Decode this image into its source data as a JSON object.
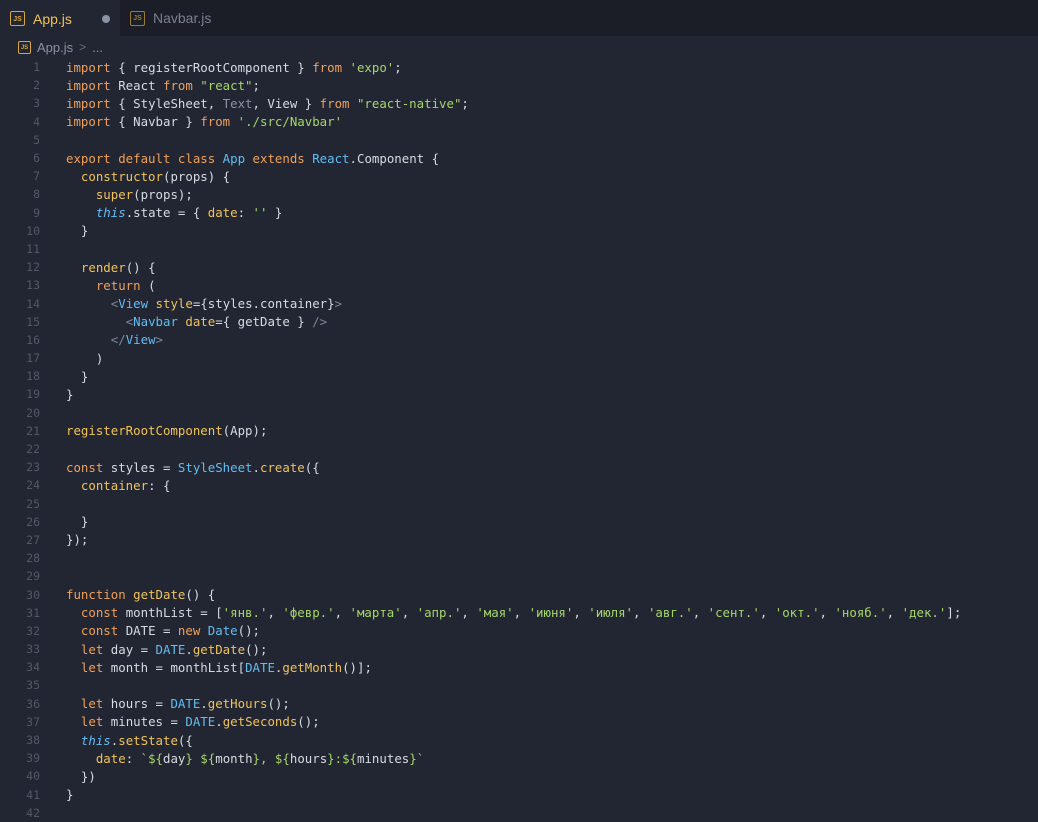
{
  "tabs": [
    {
      "label": "App.js",
      "icon_text": "JS",
      "active": true,
      "modified": true
    },
    {
      "label": "Navbar.js",
      "icon_text": "JS",
      "active": false,
      "modified": false
    }
  ],
  "breadcrumb": {
    "icon_text": "JS",
    "file": "App.js",
    "separator": ">",
    "rest": "..."
  },
  "colors": {
    "background": "#222632",
    "tabbar": "#1b1e27",
    "keyword": "#f0a05a",
    "string": "#a5d66b",
    "function": "#f0c35a",
    "class": "#61bdf2"
  },
  "lines": [
    [
      [
        "kw",
        "import"
      ],
      [
        "plain",
        " { registerRootComponent } "
      ],
      [
        "kw",
        "from"
      ],
      [
        "plain",
        " "
      ],
      [
        "str",
        "'expo'"
      ],
      [
        "plain",
        ";"
      ]
    ],
    [
      [
        "kw",
        "import"
      ],
      [
        "plain",
        " React "
      ],
      [
        "kw",
        "from"
      ],
      [
        "plain",
        " "
      ],
      [
        "str",
        "\"react\""
      ],
      [
        "plain",
        ";"
      ]
    ],
    [
      [
        "kw",
        "import"
      ],
      [
        "plain",
        " { StyleSheet, "
      ],
      [
        "dim",
        "Text"
      ],
      [
        "plain",
        ", View } "
      ],
      [
        "kw",
        "from"
      ],
      [
        "plain",
        " "
      ],
      [
        "str",
        "\"react-native\""
      ],
      [
        "plain",
        ";"
      ]
    ],
    [
      [
        "kw",
        "import"
      ],
      [
        "plain",
        " { Navbar } "
      ],
      [
        "kw",
        "from"
      ],
      [
        "plain",
        " "
      ],
      [
        "str",
        "'./src/Navbar'"
      ]
    ],
    [],
    [
      [
        "kw",
        "export default class"
      ],
      [
        "plain",
        " "
      ],
      [
        "cls",
        "App"
      ],
      [
        "plain",
        " "
      ],
      [
        "kw",
        "extends"
      ],
      [
        "plain",
        " "
      ],
      [
        "cls",
        "React"
      ],
      [
        "plain",
        "."
      ],
      [
        "plain",
        "Component {"
      ]
    ],
    [
      [
        "plain",
        "  "
      ],
      [
        "fn",
        "constructor"
      ],
      [
        "plain",
        "(props) {"
      ]
    ],
    [
      [
        "plain",
        "    "
      ],
      [
        "fn",
        "super"
      ],
      [
        "plain",
        "(props);"
      ]
    ],
    [
      [
        "plain",
        "    "
      ],
      [
        "this",
        "this"
      ],
      [
        "plain",
        ".state = { "
      ],
      [
        "fn",
        "date"
      ],
      [
        "plain",
        ": "
      ],
      [
        "str",
        "''"
      ],
      [
        "plain",
        " }"
      ]
    ],
    [
      [
        "plain",
        "  }"
      ]
    ],
    [],
    [
      [
        "plain",
        "  "
      ],
      [
        "fn",
        "render"
      ],
      [
        "plain",
        "() {"
      ]
    ],
    [
      [
        "plain",
        "    "
      ],
      [
        "kw",
        "return"
      ],
      [
        "plain",
        " ("
      ]
    ],
    [
      [
        "plain",
        "      "
      ],
      [
        "brk",
        "<"
      ],
      [
        "tag",
        "View"
      ],
      [
        "plain",
        " "
      ],
      [
        "attr",
        "style"
      ],
      [
        "plain",
        "={styles.container}"
      ],
      [
        "brk",
        ">"
      ]
    ],
    [
      [
        "plain",
        "        "
      ],
      [
        "brk",
        "<"
      ],
      [
        "tag",
        "Navbar"
      ],
      [
        "plain",
        " "
      ],
      [
        "attr",
        "date"
      ],
      [
        "plain",
        "={ getDate } "
      ],
      [
        "brk",
        "/>"
      ]
    ],
    [
      [
        "plain",
        "      "
      ],
      [
        "brk",
        "</"
      ],
      [
        "tag",
        "View"
      ],
      [
        "brk",
        ">"
      ]
    ],
    [
      [
        "plain",
        "    )"
      ]
    ],
    [
      [
        "plain",
        "  }"
      ]
    ],
    [
      [
        "plain",
        "}"
      ]
    ],
    [],
    [
      [
        "fn",
        "registerRootComponent"
      ],
      [
        "plain",
        "(App);"
      ]
    ],
    [],
    [
      [
        "kw",
        "const"
      ],
      [
        "plain",
        " styles = "
      ],
      [
        "cls",
        "StyleSheet"
      ],
      [
        "plain",
        "."
      ],
      [
        "fn",
        "create"
      ],
      [
        "plain",
        "({"
      ]
    ],
    [
      [
        "plain",
        "  "
      ],
      [
        "fn",
        "container"
      ],
      [
        "plain",
        ": {"
      ]
    ],
    [],
    [
      [
        "plain",
        "  }"
      ]
    ],
    [
      [
        "plain",
        "});"
      ]
    ],
    [],
    [],
    [
      [
        "kw",
        "function"
      ],
      [
        "plain",
        " "
      ],
      [
        "fn",
        "getDate"
      ],
      [
        "plain",
        "() {"
      ]
    ],
    [
      [
        "plain",
        "  "
      ],
      [
        "kw",
        "const"
      ],
      [
        "plain",
        " monthList = ["
      ],
      [
        "str",
        "'янв.'"
      ],
      [
        "plain",
        ", "
      ],
      [
        "str",
        "'февр.'"
      ],
      [
        "plain",
        ", "
      ],
      [
        "str",
        "'марта'"
      ],
      [
        "plain",
        ", "
      ],
      [
        "str",
        "'апр.'"
      ],
      [
        "plain",
        ", "
      ],
      [
        "str",
        "'мая'"
      ],
      [
        "plain",
        ", "
      ],
      [
        "str",
        "'июня'"
      ],
      [
        "plain",
        ", "
      ],
      [
        "str",
        "'июля'"
      ],
      [
        "plain",
        ", "
      ],
      [
        "str",
        "'авг.'"
      ],
      [
        "plain",
        ", "
      ],
      [
        "str",
        "'сент.'"
      ],
      [
        "plain",
        ", "
      ],
      [
        "str",
        "'окт.'"
      ],
      [
        "plain",
        ", "
      ],
      [
        "str",
        "'нояб.'"
      ],
      [
        "plain",
        ", "
      ],
      [
        "str",
        "'дек.'"
      ],
      [
        "plain",
        "];"
      ]
    ],
    [
      [
        "plain",
        "  "
      ],
      [
        "kw",
        "const"
      ],
      [
        "plain",
        " DATE = "
      ],
      [
        "kw",
        "new"
      ],
      [
        "plain",
        " "
      ],
      [
        "cls",
        "Date"
      ],
      [
        "plain",
        "();"
      ]
    ],
    [
      [
        "plain",
        "  "
      ],
      [
        "kw",
        "let"
      ],
      [
        "plain",
        " day = "
      ],
      [
        "cls",
        "DATE"
      ],
      [
        "plain",
        "."
      ],
      [
        "fn",
        "getDate"
      ],
      [
        "plain",
        "();"
      ]
    ],
    [
      [
        "plain",
        "  "
      ],
      [
        "kw",
        "let"
      ],
      [
        "plain",
        " month = monthList["
      ],
      [
        "cls",
        "DATE"
      ],
      [
        "plain",
        "."
      ],
      [
        "fn",
        "getMonth"
      ],
      [
        "plain",
        "()];"
      ]
    ],
    [],
    [
      [
        "plain",
        "  "
      ],
      [
        "kw",
        "let"
      ],
      [
        "plain",
        " hours = "
      ],
      [
        "cls",
        "DATE"
      ],
      [
        "plain",
        "."
      ],
      [
        "fn",
        "getHours"
      ],
      [
        "plain",
        "();"
      ]
    ],
    [
      [
        "plain",
        "  "
      ],
      [
        "kw",
        "let"
      ],
      [
        "plain",
        " minutes = "
      ],
      [
        "cls",
        "DATE"
      ],
      [
        "plain",
        "."
      ],
      [
        "fn",
        "getSeconds"
      ],
      [
        "plain",
        "();"
      ]
    ],
    [
      [
        "plain",
        "  "
      ],
      [
        "this",
        "this"
      ],
      [
        "plain",
        "."
      ],
      [
        "fn",
        "setState"
      ],
      [
        "plain",
        "({"
      ]
    ],
    [
      [
        "plain",
        "    "
      ],
      [
        "fn",
        "date"
      ],
      [
        "plain",
        ": "
      ],
      [
        "str",
        "`${"
      ],
      [
        "plain",
        "day"
      ],
      [
        "str",
        "} ${"
      ],
      [
        "plain",
        "month"
      ],
      [
        "str",
        "}, ${"
      ],
      [
        "plain",
        "hours"
      ],
      [
        "str",
        "}:${"
      ],
      [
        "plain",
        "minutes"
      ],
      [
        "str",
        "}`"
      ]
    ],
    [
      [
        "plain",
        "  })"
      ]
    ],
    [
      [
        "plain",
        "}"
      ]
    ],
    []
  ]
}
